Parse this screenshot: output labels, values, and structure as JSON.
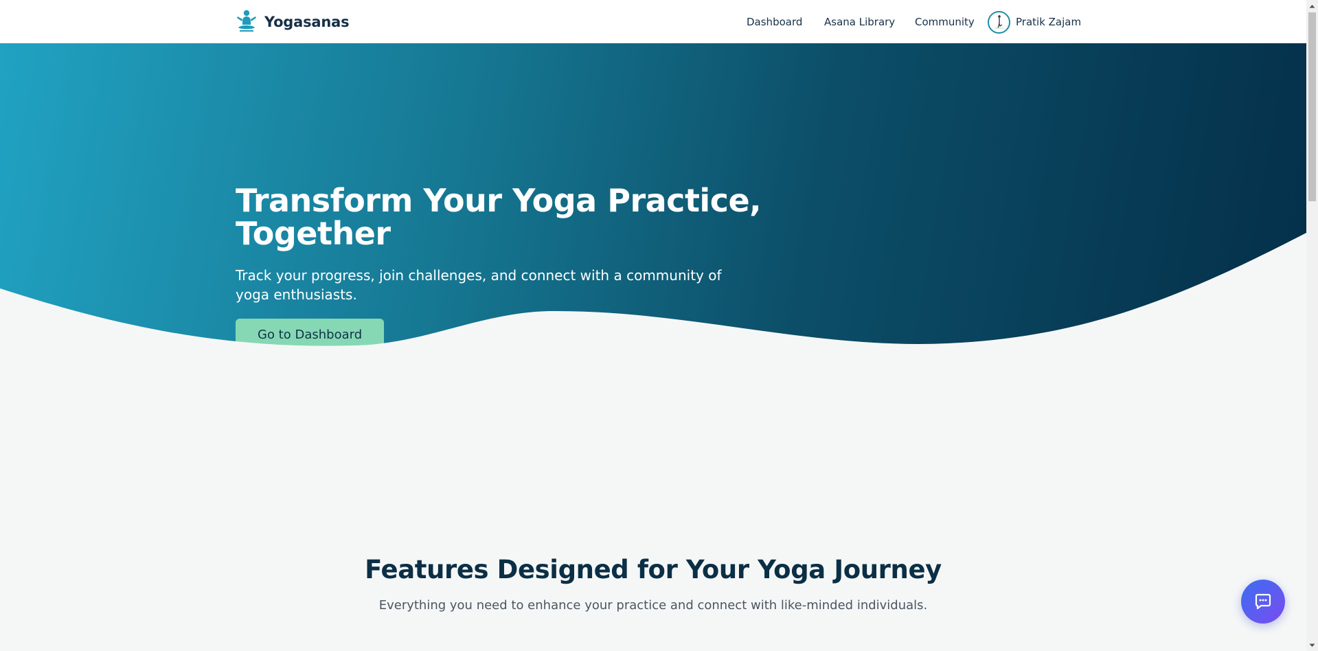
{
  "navbar": {
    "brand_name": "Yogasanas",
    "brand_icon": "meditation-figure-icon",
    "links": [
      {
        "label": "Dashboard"
      },
      {
        "label": "Asana Library"
      },
      {
        "label": "Community"
      }
    ],
    "user": {
      "name": "Pratik Zajam",
      "avatar_icon": "user-avatar"
    }
  },
  "hero": {
    "title_line1": "Transform Your Yoga Practice,",
    "title_line2": "Together",
    "subtitle": "Track your progress, join challenges, and connect with a community of yoga enthusiasts.",
    "cta_label": "Go to Dashboard",
    "gradient_start": "#21a2c2",
    "gradient_end": "#042f49"
  },
  "features": {
    "title": "Features Designed for Your Yoga Journey",
    "subtitle": "Everything you need to enhance your practice and connect with like-minded individuals."
  },
  "chat": {
    "icon": "chat-bubble-icon",
    "gradient_start": "#3c6ff0",
    "gradient_end": "#7a4bf0"
  },
  "colors": {
    "page_background": "#f5f7f7",
    "heading": "#0b2f45",
    "cta_background": "#86d8b4"
  }
}
